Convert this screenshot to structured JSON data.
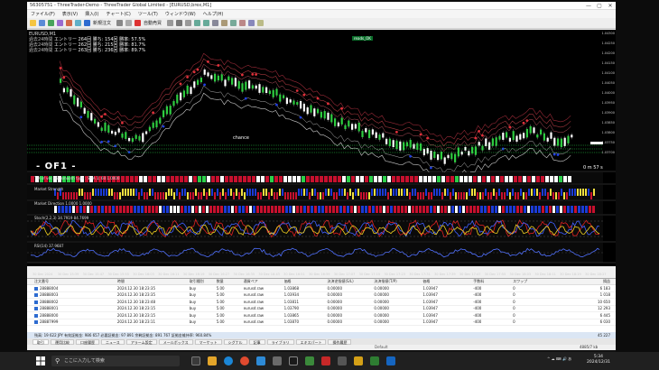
{
  "window": {
    "title": "56305751 - ThreeTrader-Demo - ThreeTrader Global Limited - [EURUSD,brex,M1]",
    "minimize": "—",
    "maximize": "▢",
    "close": "✕"
  },
  "menu": {
    "items": [
      "ファイル(F)",
      "表示(V)",
      "挿入(I)",
      "チャート(C)",
      "ツール(T)",
      "ウィンドウ(W)",
      "ヘルプ(H)"
    ]
  },
  "toolbar": {
    "new_order": "新規注文",
    "auto_trading": "自動売買"
  },
  "chart": {
    "symbol_label": "EURUSD,M1",
    "stats": [
      {
        "label": "過去24時間",
        "entries": "エントリー 264回",
        "wins": "勝ち: 154回",
        "rate": "勝率: 57.5%"
      },
      {
        "label": "過去24時間",
        "entries": "エントリー 262回",
        "wins": "勝ち: 215回",
        "rate": "勝率: 81.7%"
      },
      {
        "label": "過去24時間",
        "entries": "エントリー 263回",
        "wins": "勝ち: 236回",
        "rate": "勝率: 89.7%"
      }
    ],
    "badge": "reads_OK",
    "main_label": "- OF1 -",
    "timer": "0 m 57 s",
    "chance": "chance",
    "panels": {
      "p1": "TDI of ver. BB, smooth type : SMA 1; 60 1.0000",
      "p2": "Market Strength",
      "p3": "Market Direction 1.0000 1.0000",
      "p4": "Stoch(2,2,3) 34.7919 84.7699",
      "p5": "RSI(14) 37.9687"
    },
    "y_ticks": [
      "1.04300",
      "1.04250",
      "1.04200",
      "1.04150",
      "1.04100",
      "1.04050",
      "1.04000",
      "1.03950",
      "1.03900",
      "1.03850",
      "1.03800",
      "1.03750",
      "1.03700"
    ],
    "x_ticks": [
      "30 Dec 2024",
      "30 Dec 15:39",
      "30 Dec 15:47",
      "30 Dec 15:55",
      "30 Dec 16:03",
      "30 Dec 16:11",
      "30 Dec 16:19",
      "30 Dec 16:27",
      "30 Dec 16:35",
      "30 Dec 16:43",
      "30 Dec 16:51",
      "30 Dec 16:59",
      "30 Dec 17:07",
      "30 Dec 17:15",
      "30 Dec 17:23",
      "30 Dec 17:31",
      "30 Dec 17:39",
      "30 Dec 17:47",
      "30 Dec 17:55",
      "30 Dec 18:03",
      "30 Dec 18:11",
      "30 Dec 18:19",
      "30 Dec 18:27"
    ]
  },
  "terminal": {
    "headers": [
      "注文番号",
      "時間",
      "取引種別",
      "数量",
      "通貨ペア",
      "価格",
      "決済逆指値(S/L)",
      "決済指値(T/P)",
      "価格",
      "手数料",
      "スワップ",
      "損益"
    ],
    "rows": [
      {
        "id": "28888004",
        "time": "2024.12.30 18:23:35",
        "type": "buy",
        "lots": "5.00",
        "symbol": "eurusd.raw",
        "price": "1.03868",
        "sl": "0.00000",
        "tp": "0.00000",
        "cur": "1.03947",
        "fee": "-400",
        "swap": "0",
        "profit": "6 183"
      },
      {
        "id": "28888003",
        "time": "2024.12.30 18:23:35",
        "type": "buy",
        "lots": "5.00",
        "symbol": "eurusd.raw",
        "price": "1.03934",
        "sl": "0.00000",
        "tp": "0.00000",
        "cur": "1.03947",
        "fee": "-400",
        "swap": "0",
        "profit": "1 018"
      },
      {
        "id": "28888002",
        "time": "2024.12.30 18:23:48",
        "type": "buy",
        "lots": "5.00",
        "symbol": "eurusd.raw",
        "price": "1.03811",
        "sl": "0.00000",
        "tp": "0.00000",
        "cur": "1.03947",
        "fee": "-400",
        "swap": "0",
        "profit": "10 650"
      },
      {
        "id": "28888001",
        "time": "2024.12.30 18:23:15",
        "type": "buy",
        "lots": "5.00",
        "symbol": "eurusd.raw",
        "price": "1.03790",
        "sl": "0.00000",
        "tp": "0.00000",
        "cur": "1.03947",
        "fee": "-400",
        "swap": "0",
        "profit": "12 293"
      },
      {
        "id": "28888000",
        "time": "2024.12.30 18:23:15",
        "type": "buy",
        "lots": "5.00",
        "symbol": "eurusd.raw",
        "price": "1.03865",
        "sl": "0.00000",
        "tp": "0.00000",
        "cur": "1.03947",
        "fee": "-400",
        "swap": "0",
        "profit": "6 445"
      },
      {
        "id": "28887999",
        "time": "2024.12.30 18:23:11",
        "type": "buy",
        "lots": "5.00",
        "symbol": "eurusd.raw",
        "price": "1.03870",
        "sl": "0.00000",
        "tp": "0.00000",
        "cur": "1.03947",
        "fee": "-400",
        "swap": "0",
        "profit": "6 030"
      }
    ],
    "total_text": "残高: 19 622 JPY 有効証拠金: 986 657 必要証拠金: 97 891 余剰証拠金: 891 767 証拠金維持率: 960.84%",
    "total_profit": "45 227"
  },
  "tabs": [
    "取引",
    "運用比較",
    "口座履歴",
    "ニュース",
    "アラーム設定",
    "メールボックス",
    "マーケット",
    "シグナル",
    "記事",
    "ライブラリ",
    "エキスパート",
    "操作履歴"
  ],
  "status": {
    "default": "Default",
    "right": "4885/7 kb"
  },
  "taskbar": {
    "search_placeholder": "ここに入力して検索",
    "time": "5:34",
    "date": "2024/12/31",
    "tray": "^ ☁ ⌨ 🔊 あ"
  },
  "colors": {
    "bull_candle": "#2ecc40",
    "bear_candle": "#ffffff",
    "accent_red": "#e0303a",
    "accent_blue": "#2040e0",
    "accent_yellow": "#f0e040"
  }
}
